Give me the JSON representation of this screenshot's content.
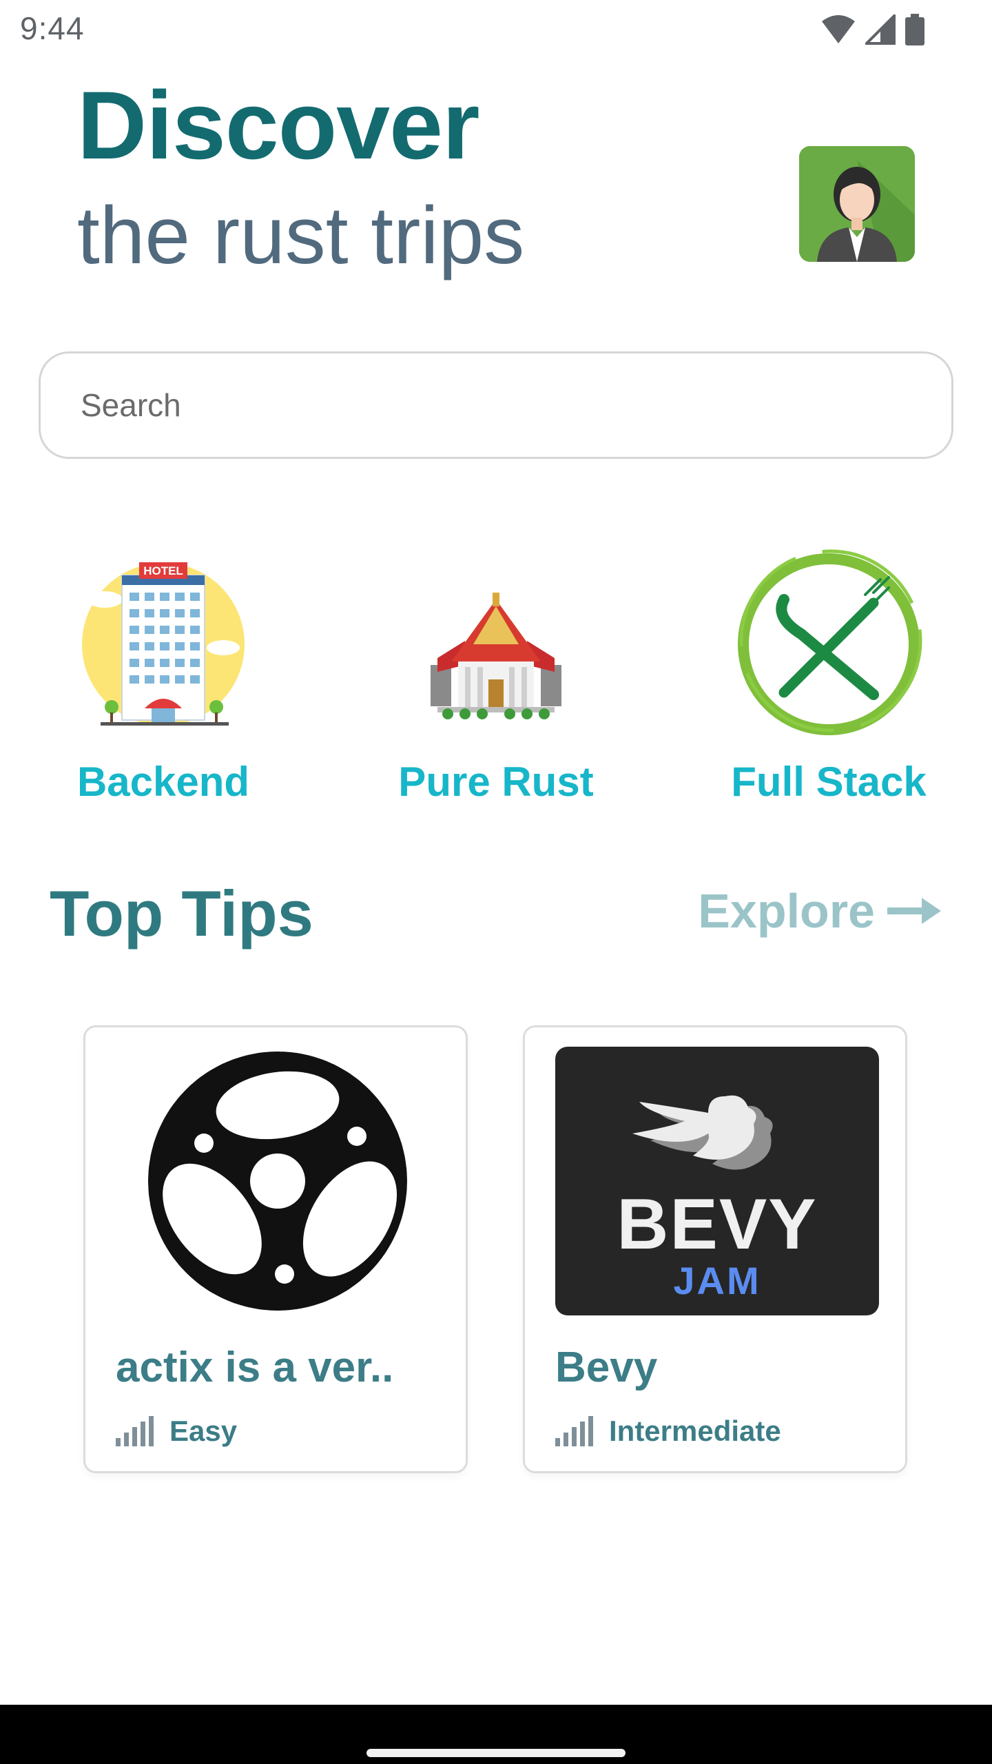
{
  "status_bar": {
    "time": "9:44"
  },
  "header": {
    "title": "Discover",
    "subtitle": "the rust trips"
  },
  "search": {
    "placeholder": "Search",
    "value": ""
  },
  "categories": [
    {
      "label": "Backend",
      "icon": "hotel-icon"
    },
    {
      "label": "Pure Rust",
      "icon": "temple-icon"
    },
    {
      "label": "Full Stack",
      "icon": "fork-knife-icon"
    }
  ],
  "top_tips": {
    "title": "Top Tips",
    "explore_label": "Explore"
  },
  "cards": [
    {
      "name": "actix is a ver..",
      "level": "Easy",
      "image": "actix-logo",
      "level_icon": "signal-bars-icon"
    },
    {
      "name": "Bevy",
      "level": "Intermediate",
      "image": "bevy-jam-logo",
      "level_icon": "signal-bars-icon"
    }
  ],
  "bevy_logo": {
    "line1": "BEVY",
    "line2": "JAM"
  },
  "colors": {
    "title": "#136b70",
    "subtitle": "#516a7e",
    "category_label": "#17b6c9",
    "section_title": "#2f7a80",
    "explore": "#9bc4c8"
  }
}
